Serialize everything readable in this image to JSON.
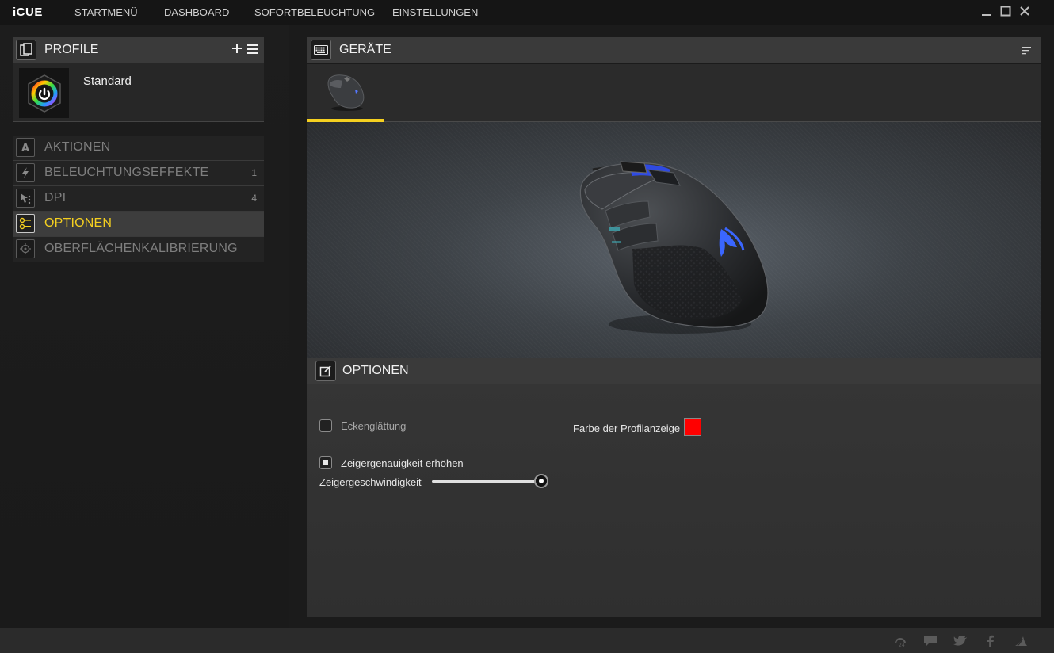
{
  "app": {
    "brand": "iCUE"
  },
  "nav": {
    "items": [
      {
        "label": "STARTMENÜ"
      },
      {
        "label": "DASHBOARD"
      },
      {
        "label": "SOFORTBELEUCHTUNG"
      },
      {
        "label": "EINSTELLUNGEN"
      }
    ]
  },
  "window_controls": {
    "icons": [
      "minimize-icon",
      "maximize-icon",
      "close-icon"
    ]
  },
  "profiles": {
    "title": "PROFILE",
    "add_icon": "plus-icon",
    "menu_icon": "hamburger-icon",
    "current": {
      "name": "Standard",
      "icon": "icue-logo"
    }
  },
  "menu": {
    "items": [
      {
        "label": "AKTIONEN",
        "count": "",
        "icon": "letter-a-icon",
        "active": false
      },
      {
        "label": "BELEUCHTUNGSEFFEKTE",
        "count": "1",
        "icon": "lightning-icon",
        "active": false
      },
      {
        "label": "DPI",
        "count": "4",
        "icon": "cursor-dpi-icon",
        "active": false
      },
      {
        "label": "OPTIONEN",
        "count": "",
        "icon": "options-icon",
        "active": true
      },
      {
        "label": "OBERFLÄCHENKALIBRIERUNG",
        "count": "",
        "icon": "crosshair-icon",
        "active": false
      }
    ]
  },
  "devices": {
    "title": "GERÄTE",
    "icon": "keyboard-icon",
    "menu_icon": "list-menu-icon",
    "selected": {
      "icon": "mouse-device-icon"
    }
  },
  "options": {
    "title": "OPTIONEN",
    "icon": "edit-icon",
    "angle_snapping": {
      "label": "Eckenglättung",
      "checked": false
    },
    "enhance_precision": {
      "label": "Zeigergenauigkeit erhöhen",
      "checked": true
    },
    "pointer_speed": {
      "label": "Zeigergeschwindigkeit",
      "value": 1.0
    },
    "profile_color": {
      "label": "Farbe der Profilanzeige",
      "color": "#ff0000"
    }
  },
  "colors": {
    "accent": "#f5d020",
    "profile_indicator": "#ff0000"
  },
  "footer": {
    "icons": [
      "support-24-icon",
      "chat-icon",
      "twitter-icon",
      "facebook-icon",
      "corsair-icon"
    ]
  }
}
